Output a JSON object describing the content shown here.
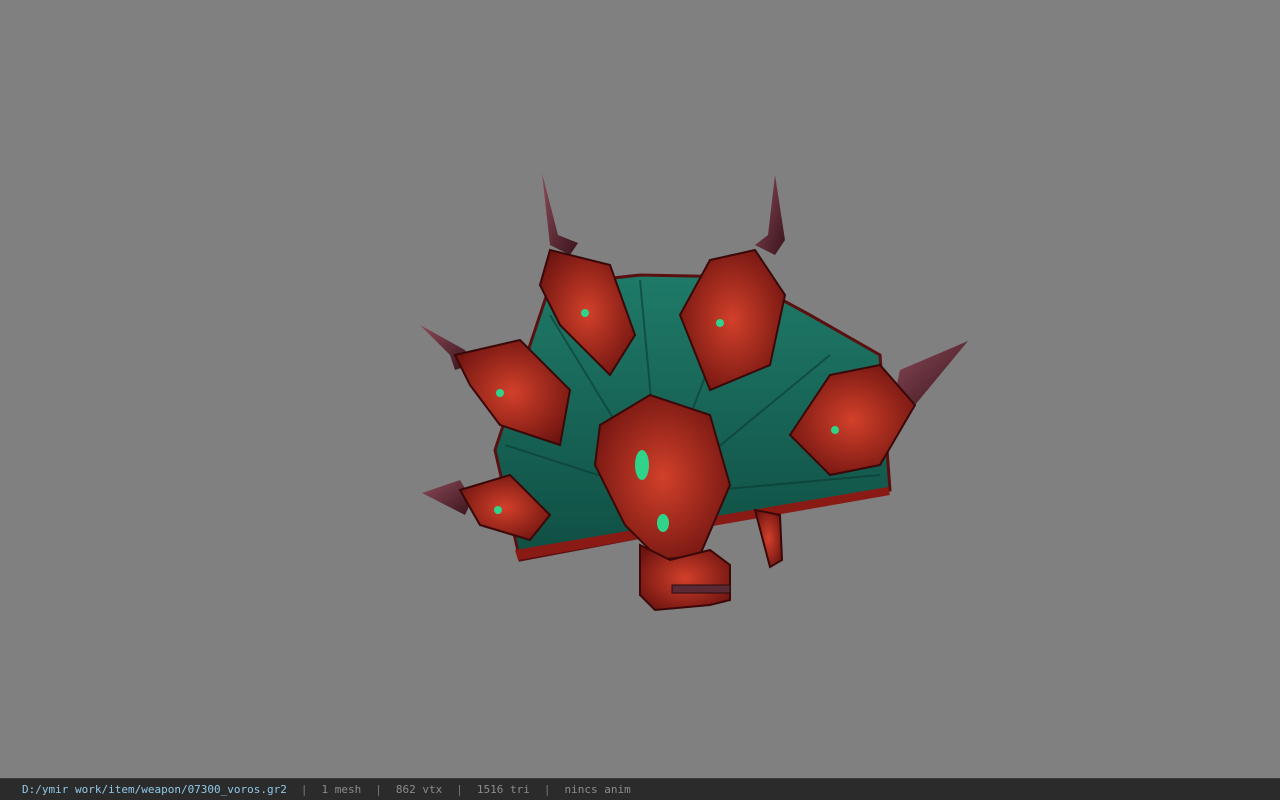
{
  "viewer": {
    "background_color": "#808080",
    "model_icon": "spiked-fan-weapon-model"
  },
  "status": {
    "file_path": "D:/ymir work/item/weapon/07300_voros.gr2",
    "separator": "|",
    "mesh_count": "1 mesh",
    "vertex_count": "862 vtx",
    "triangle_count": "1516 tri",
    "animation": "nincs anim"
  }
}
